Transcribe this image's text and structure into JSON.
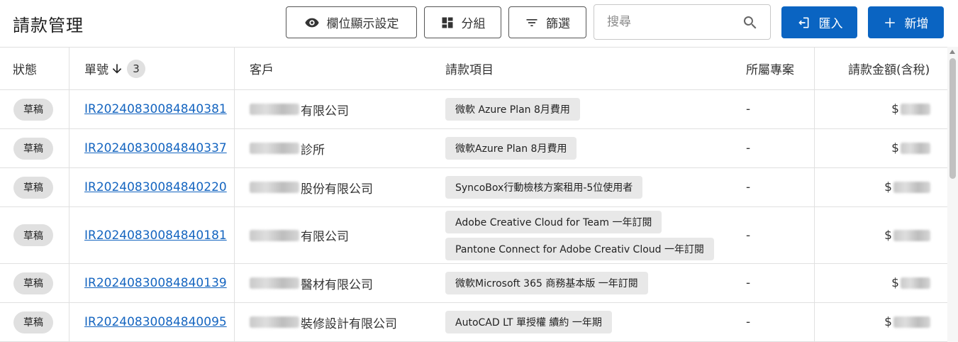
{
  "page": {
    "title": "請款管理"
  },
  "toolbar": {
    "column_settings_label": "欄位顯示設定",
    "group_label": "分組",
    "filter_label": "篩選",
    "search_placeholder": "搜尋",
    "import_label": "匯入",
    "add_label": "新增"
  },
  "colors": {
    "primary": "#0a64c2",
    "link": "#1565c0",
    "chip_bg": "#e0e0e0",
    "item_chip_bg": "#e8e8e8",
    "border": "#e0e0e0"
  },
  "table": {
    "headers": {
      "status": "狀態",
      "number": "單號",
      "sort_count": "3",
      "customer": "客戶",
      "items": "請款項目",
      "project": "所屬專案",
      "amount": "請款金額(含稅)"
    },
    "rows": [
      {
        "status": "草稿",
        "number": "IR20240830084840381",
        "customer_suffix": "有限公司",
        "items": [
          "微軟 Azure Plan 8月費用"
        ],
        "project": "-",
        "amount_prefix": "$"
      },
      {
        "status": "草稿",
        "number": "IR20240830084840337",
        "customer_suffix": "診所",
        "items": [
          "微軟Azure Plan 8月費用"
        ],
        "project": "-",
        "amount_prefix": "$"
      },
      {
        "status": "草稿",
        "number": "IR20240830084840220",
        "customer_suffix": "股份有限公司",
        "items": [
          "SyncoBox行動檢核方案租用-5位使用者"
        ],
        "project": "-",
        "amount_prefix": "$"
      },
      {
        "status": "草稿",
        "number": "IR20240830084840181",
        "customer_suffix": "有限公司",
        "items": [
          "Adobe Creative Cloud for Team 一年訂閱",
          "Pantone Connect for Adobe Creativ Cloud 一年訂閱"
        ],
        "project": "-",
        "amount_prefix": "$"
      },
      {
        "status": "草稿",
        "number": "IR20240830084840139",
        "customer_suffix": "醫材有限公司",
        "items": [
          "微軟Microsoft 365 商務基本版 一年訂閱"
        ],
        "project": "-",
        "amount_prefix": "$"
      },
      {
        "status": "草稿",
        "number": "IR20240830084840095",
        "customer_suffix": "裝修設計有限公司",
        "items": [
          "AutoCAD LT 單授權 續約 一年期"
        ],
        "project": "-",
        "amount_prefix": "$"
      }
    ]
  }
}
